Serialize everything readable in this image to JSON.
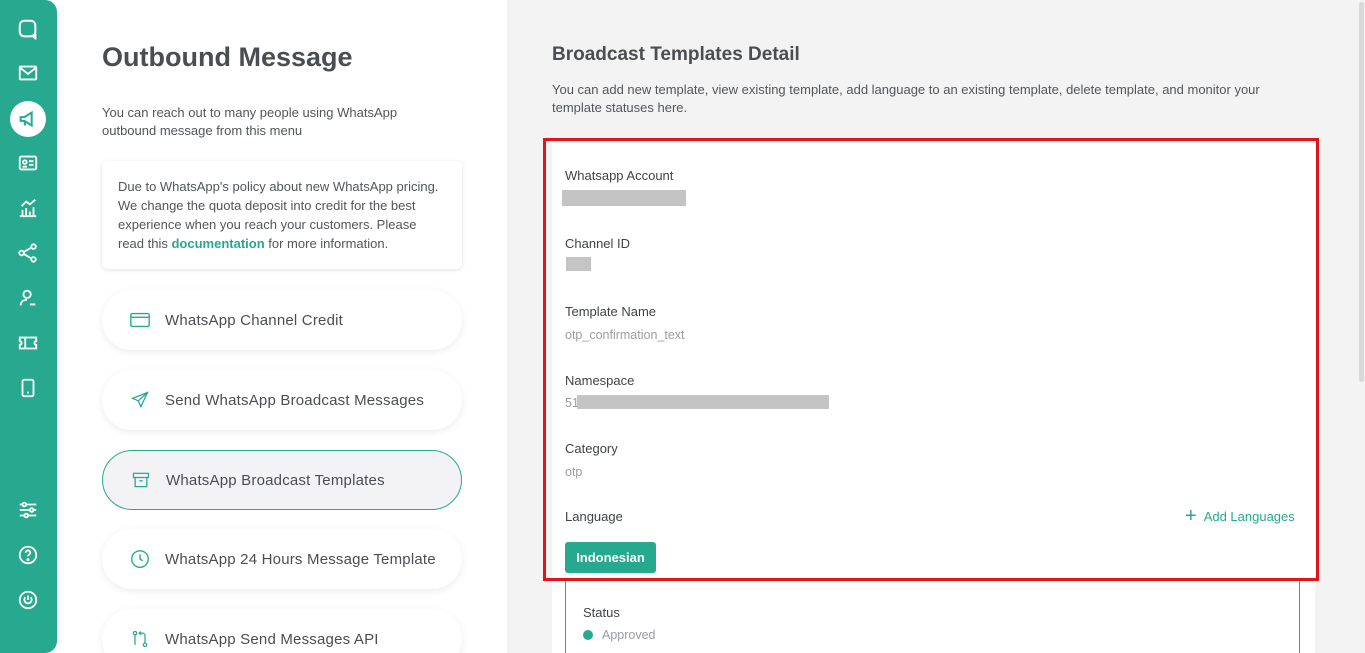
{
  "sidebar": {
    "icons": [
      "chat-icon",
      "mail-icon",
      "megaphone-icon",
      "contact-card-icon",
      "analytics-icon",
      "share-nodes-icon",
      "user-icon",
      "ticket-icon",
      "mobile-icon",
      "settings-sliders-icon",
      "help-icon",
      "power-icon"
    ],
    "active": "megaphone-icon"
  },
  "left": {
    "title": "Outbound Message",
    "description": "You can reach out to many people using WhatsApp outbound message from this menu",
    "notice": {
      "text_before": "Due to WhatsApp's policy about new WhatsApp pricing. We change the quota deposit into credit for the best experience when you reach your customers. Please read this ",
      "link": "documentation",
      "text_after": " for more information."
    },
    "menu": [
      {
        "label": "WhatsApp Channel Credit",
        "icon": "credit-card-icon"
      },
      {
        "label": "Send WhatsApp Broadcast Messages",
        "icon": "send-icon"
      },
      {
        "label": "WhatsApp Broadcast Templates",
        "icon": "archive-icon"
      },
      {
        "label": "WhatsApp 24 Hours Message Template",
        "icon": "clock-icon"
      },
      {
        "label": "WhatsApp Send Messages API",
        "icon": "api-icon"
      }
    ]
  },
  "detail": {
    "title": "Broadcast Templates Detail",
    "description": "You can add new template, view existing template, add language to an existing template, delete template, and monitor your template statuses here.",
    "fields": {
      "whatsapp_account_label": "Whatsapp Account",
      "channel_id_label": "Channel ID",
      "template_name_label": "Template Name",
      "template_name_value": "otp_confirmation_text",
      "namespace_label": "Namespace",
      "namespace_value_prefix": "51",
      "category_label": "Category",
      "category_value": "otp",
      "language_label": "Language"
    },
    "add_languages": "Add Languages",
    "language_button": "Indonesian",
    "status": {
      "label": "Status",
      "value": "Approved",
      "color": "#27a98f"
    }
  },
  "colors": {
    "accent": "#27a98f",
    "highlight": "#e0141e"
  }
}
